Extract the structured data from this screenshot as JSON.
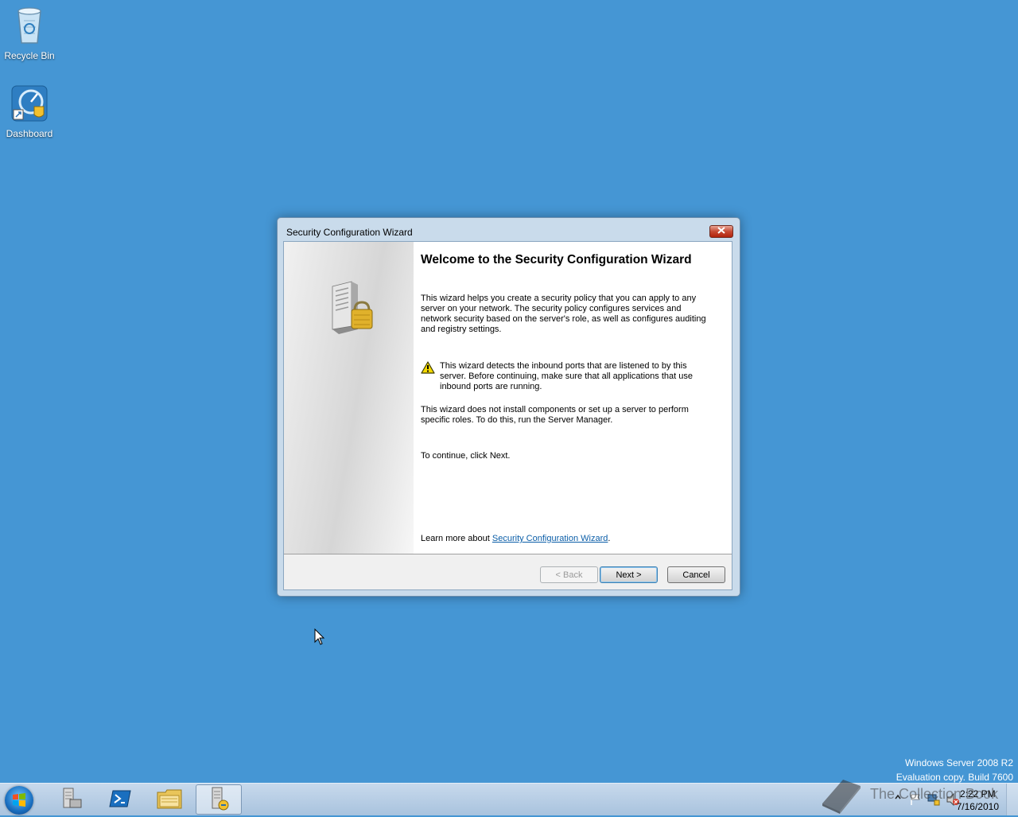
{
  "desktop": {
    "icons": [
      {
        "label": "Recycle Bin",
        "icon": "recycle-bin-icon"
      },
      {
        "label": "Dashboard",
        "icon": "dashboard-icon"
      }
    ],
    "watermark": {
      "line1": "Windows Server 2008 R2",
      "line2": "Evaluation copy. Build 7600"
    }
  },
  "dialog": {
    "title": "Security Configuration Wizard",
    "heading": "Welcome to the Security Configuration Wizard",
    "para1": "This wizard helps you create a security policy that you can apply to any server on your network. The security policy configures services and network security based on the server's role, as well as configures auditing and registry settings.",
    "warning": "This wizard detects the inbound ports that are listened to by this server. Before continuing, make sure that all applications that use inbound ports are running.",
    "para2": "This wizard does not install components or set up a server to perform specific roles. To do this, run the Server Manager.",
    "para3": "To continue, click Next.",
    "learn_more_prefix": "Learn more about ",
    "learn_more_link": "Security Configuration Wizard",
    "learn_more_suffix": ".",
    "buttons": {
      "back": "< Back",
      "next": "Next >",
      "cancel": "Cancel"
    }
  },
  "taskbar": {
    "items": [
      "start-orb-icon",
      "server-manager-icon",
      "powershell-icon",
      "explorer-icon",
      "security-wizard-icon"
    ],
    "clock_time": "2:22 PM",
    "clock_date": "7/16/2010",
    "overlay_text": "The Collection Book"
  },
  "colors": {
    "desktop": "#4596d4",
    "link": "#0b5ea8"
  }
}
